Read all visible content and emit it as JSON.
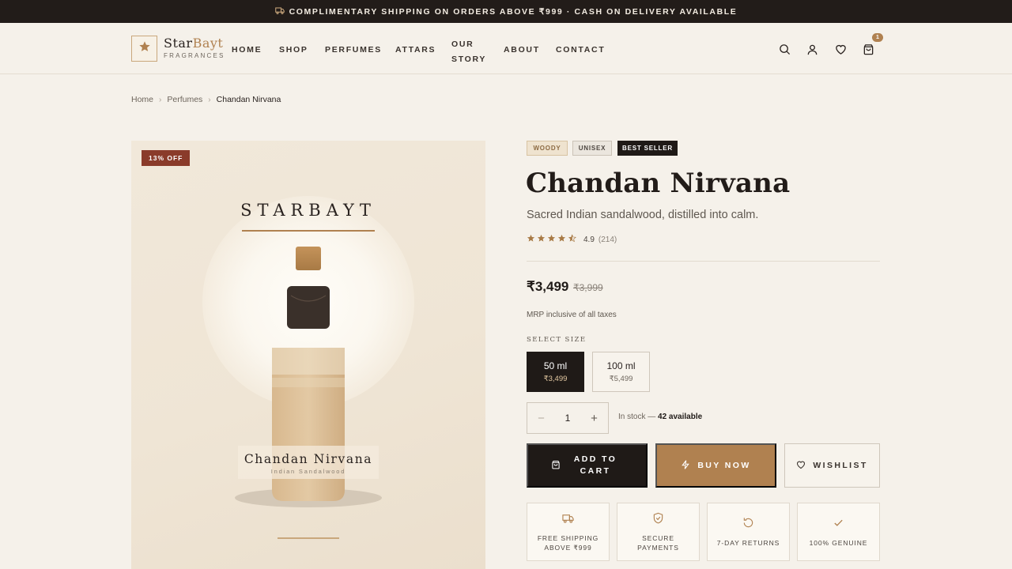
{
  "announcement": {
    "text": "COMPLIMENTARY SHIPPING ON ORDERS ABOVE ₹999 · CASH ON DELIVERY AVAILABLE",
    "icon": "truck-icon"
  },
  "brand": {
    "name_part1": "Star",
    "name_part2": "Bayt",
    "tagline": "FRAGRANCES",
    "logo_icon": "star-icon"
  },
  "nav": {
    "home": "HOME",
    "shop": "SHOP",
    "perfumes": "PERFUMES",
    "attars": "ATTARS",
    "our_story_line1": "OUR",
    "our_story_line2": "STORY",
    "about": "ABOUT",
    "contact": "CONTACT"
  },
  "header_icons": {
    "search": "search-icon",
    "account": "user-icon",
    "wishlist": "heart-icon",
    "cart": "bag-icon",
    "cart_count": "1"
  },
  "breadcrumb": {
    "items": [
      "Home",
      "Perfumes",
      "Chandan Nirvana"
    ],
    "separator": "›"
  },
  "gallery": {
    "discount_badge": "13% OFF",
    "brand_word": "STARBAYT",
    "label_name": "Chandan Nirvana",
    "label_sub": "Indian Sandalwood"
  },
  "product": {
    "tags": [
      "WOODY",
      "UNISEX",
      "BEST SELLER"
    ],
    "title": "Chandan Nirvana",
    "subtitle": "Sacred Indian sandalwood, distilled into calm.",
    "rating": {
      "stars": 4.5,
      "value": "4.9",
      "count": "(214)"
    },
    "price": "₹3,499",
    "price_old": "₹3,999",
    "tax_note": "MRP inclusive of all taxes",
    "size_label": "SELECT SIZE",
    "sizes": [
      {
        "label": "50 ml",
        "price": "₹3,499",
        "selected": true
      },
      {
        "label": "100 ml",
        "price": "₹5,499",
        "selected": false
      }
    ],
    "quantity": {
      "value": "1",
      "minus": "−",
      "plus": "+"
    },
    "stock": {
      "text": "In stock — ",
      "count": "42 available"
    }
  },
  "actions": {
    "add_to_cart": "ADD TO CART",
    "buy_now": "BUY NOW",
    "wishlist": "WISHLIST"
  },
  "features": [
    {
      "label": "FREE SHIPPING ABOVE ₹999",
      "icon": "truck-icon"
    },
    {
      "label": "SECURE PAYMENTS",
      "icon": "shield-icon"
    },
    {
      "label": "7-DAY RETURNS",
      "icon": "refresh-icon"
    },
    {
      "label": "100% GENUINE",
      "icon": "check-icon"
    }
  ],
  "colors": {
    "accent": "#b08150",
    "dark": "#1f1a17",
    "background": "#f5f1ea",
    "discount": "#8a3b2a"
  }
}
